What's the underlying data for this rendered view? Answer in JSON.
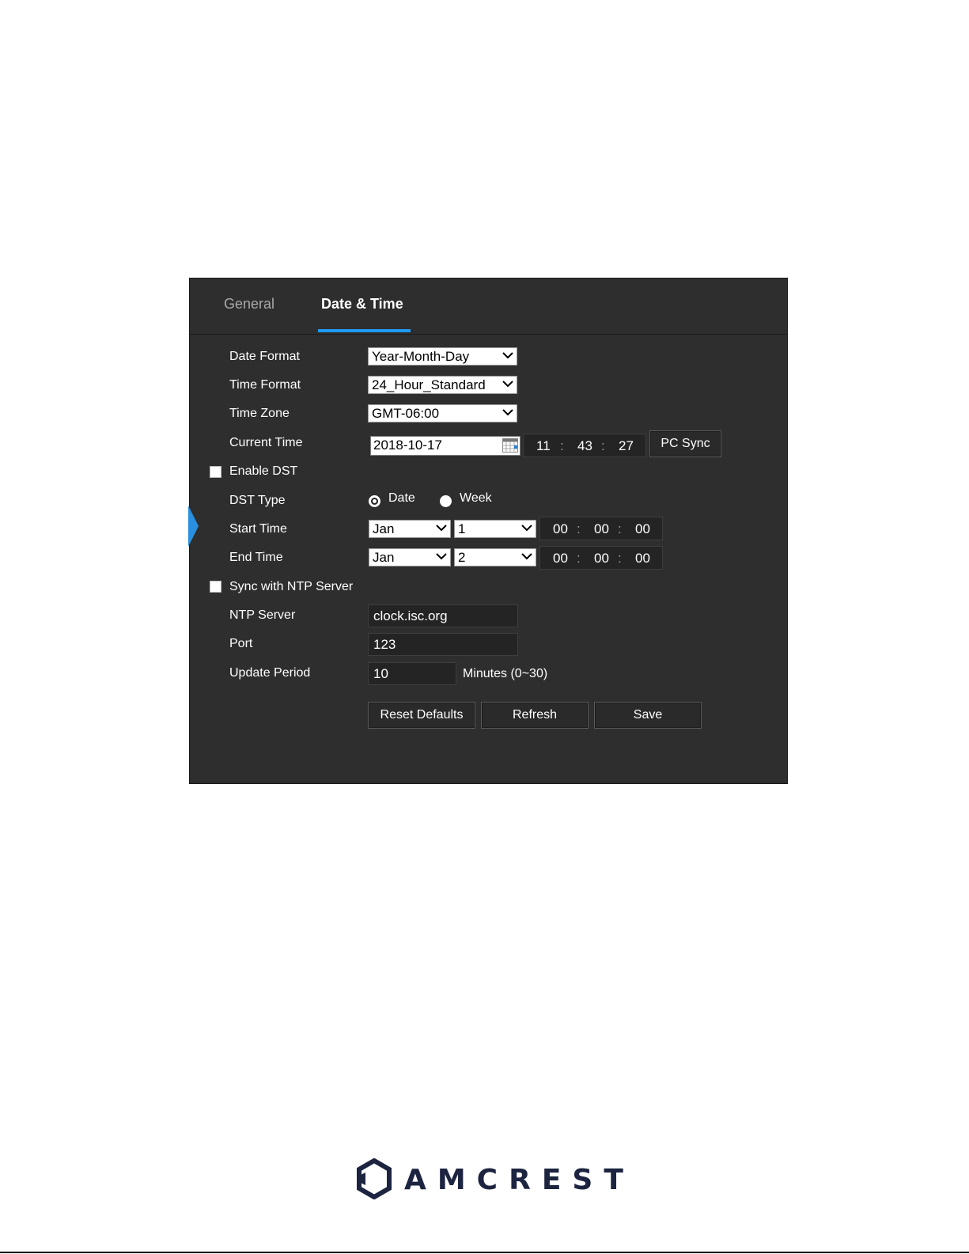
{
  "tabs": [
    {
      "label": "General",
      "active": false
    },
    {
      "label": "Date & Time",
      "active": true
    }
  ],
  "accent_color": "#1e9bf0",
  "form": {
    "date_format": {
      "label": "Date Format",
      "value": "Year-Month-Day"
    },
    "time_format": {
      "label": "Time Format",
      "value": "24_Hour_Standard"
    },
    "time_zone": {
      "label": "Time Zone",
      "value": "GMT-06:00"
    },
    "current_time": {
      "label": "Current Time",
      "date": "2018-10-17",
      "hour": "11",
      "minute": "43",
      "second": "27",
      "sep": ":",
      "pc_sync": "PC Sync"
    },
    "enable_dst": {
      "label": "Enable DST",
      "checked": false
    },
    "dst_type": {
      "label": "DST Type",
      "options": [
        "Date",
        "Week"
      ],
      "selected": "Date"
    },
    "start_time": {
      "label": "Start Time",
      "month": "Jan",
      "day": "1",
      "hour": "00",
      "minute": "00",
      "second": "00"
    },
    "end_time": {
      "label": "End Time",
      "month": "Jan",
      "day": "2",
      "hour": "00",
      "minute": "00",
      "second": "00"
    },
    "sync_ntp": {
      "label": "Sync with NTP Server",
      "checked": false
    },
    "ntp_server": {
      "label": "NTP Server",
      "value": "clock.isc.org"
    },
    "port": {
      "label": "Port",
      "value": "123"
    },
    "update_period": {
      "label": "Update Period",
      "value": "10",
      "hint": "Minutes (0~30)"
    }
  },
  "buttons": {
    "reset": "Reset Defaults",
    "refresh": "Refresh",
    "save": "Save"
  },
  "logo": {
    "text": "AMCREST",
    "icon": "amcrest-hexagon-logo"
  }
}
